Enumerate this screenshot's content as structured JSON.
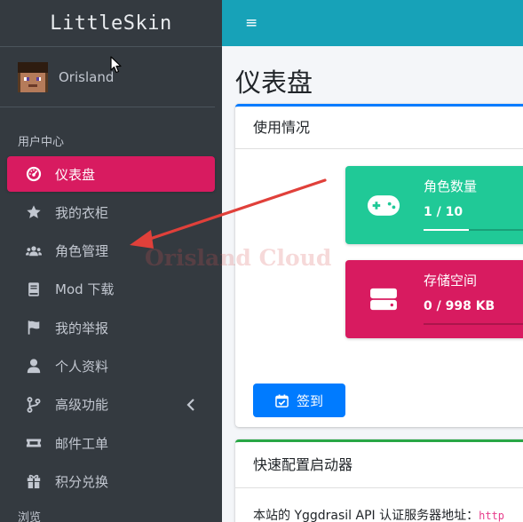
{
  "brand": {
    "name": "LittleSkin"
  },
  "user": {
    "name": "Orisland"
  },
  "sidebar": {
    "header": "用户中心",
    "items": [
      {
        "label": "仪表盘",
        "icon": "tachometer-icon",
        "active": true
      },
      {
        "label": "我的衣柜",
        "icon": "star-icon"
      },
      {
        "label": "角色管理",
        "icon": "users-icon"
      },
      {
        "label": "Mod 下载",
        "icon": "book-icon"
      },
      {
        "label": "我的举报",
        "icon": "flag-icon"
      },
      {
        "label": "个人资料",
        "icon": "user-icon"
      },
      {
        "label": "高级功能",
        "icon": "code-branch-icon"
      },
      {
        "label": "邮件工单",
        "icon": "ticket-icon"
      },
      {
        "label": "积分兑换",
        "icon": "gift-icon"
      }
    ],
    "header2": "浏览"
  },
  "topbar": {
    "menu_icon": "≡"
  },
  "page": {
    "title": "仪表盘"
  },
  "usage_card": {
    "title": "使用情况",
    "players": {
      "label": "角色数量",
      "value": "1 / 10",
      "progress": 0.1,
      "color": "#20c997"
    },
    "storage": {
      "label": "存储空间",
      "value": "0 / 998 KB",
      "progress": 0.0,
      "color": "#d81b60"
    },
    "checkin_label": "签到"
  },
  "launcher_card": {
    "title": "快速配置启动器",
    "text": "本站的 Yggdrasil API 认证服务器地址：",
    "url_fragment": "http"
  },
  "watermark": "Orisland Cloud",
  "colors": {
    "sidebar": "#343a40",
    "topbar": "#17a2b8",
    "active": "#d81b60",
    "primary": "#007bff",
    "teal": "#20c997",
    "success": "#28a745"
  }
}
